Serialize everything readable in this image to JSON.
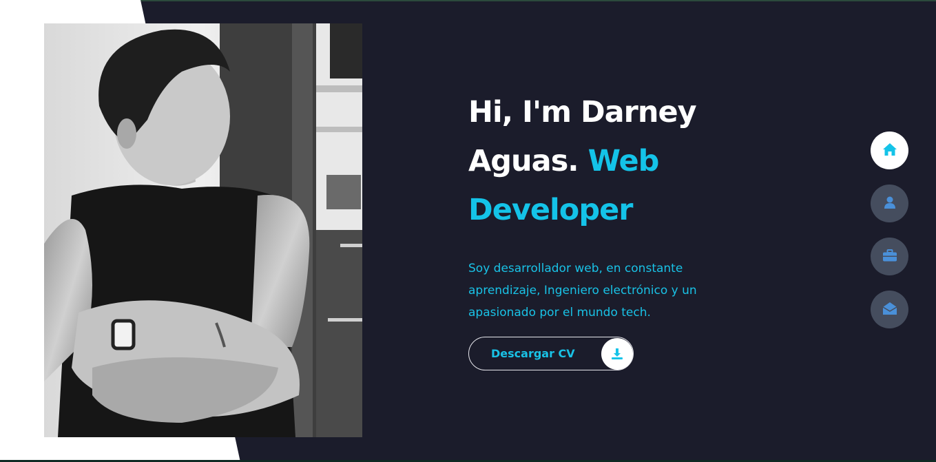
{
  "hero": {
    "title_line1": "Hi, I'm Darney",
    "title_line2": "Aguas.",
    "title_accent_word": "Web",
    "title_line3": "Developer",
    "description": "Soy desarrollador web, en constante aprendizaje, Ingeniero electrónico y un apasionado por el mundo tech.",
    "cv_button_label": "Descargar CV",
    "cv_icon": "download-icon"
  },
  "nav": {
    "items": [
      {
        "icon": "home-icon",
        "active": true
      },
      {
        "icon": "user-icon",
        "active": false
      },
      {
        "icon": "briefcase-icon",
        "active": false
      },
      {
        "icon": "envelope-open-icon",
        "active": false
      }
    ]
  },
  "colors": {
    "background": "#1b1c2b",
    "accent": "#14c3e8",
    "nav_inactive": "#454d5e",
    "nav_icon_inactive": "#4a90d9"
  }
}
